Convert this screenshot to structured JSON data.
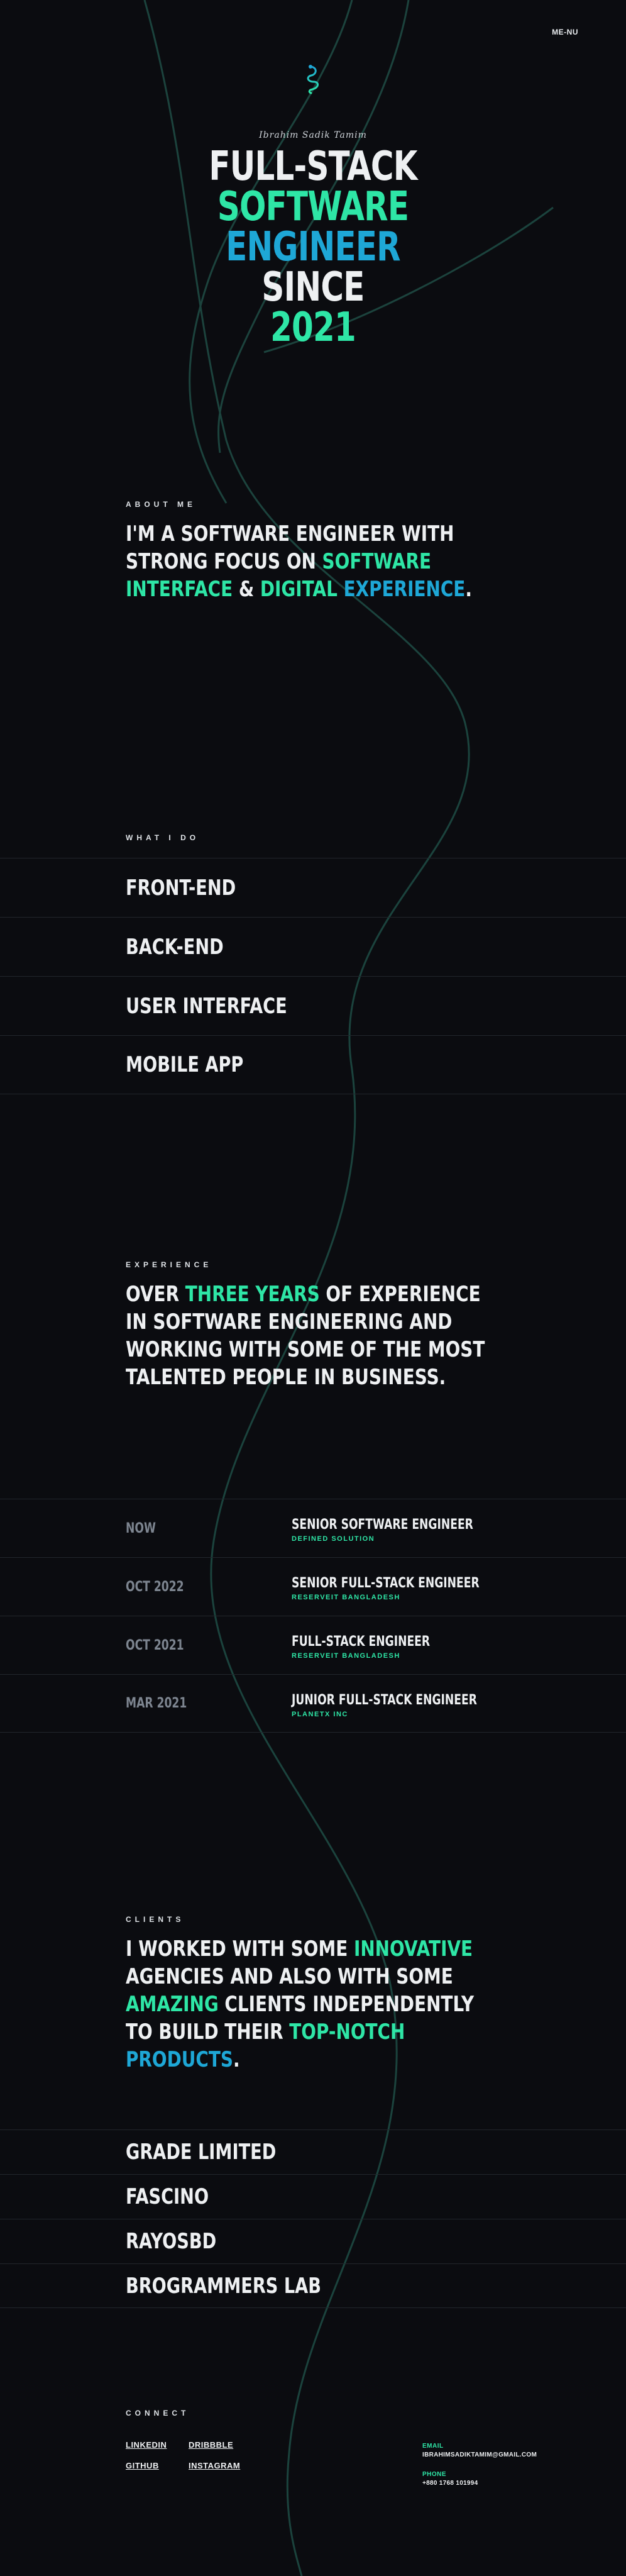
{
  "nav": {
    "menu_label": "ME-NU"
  },
  "hero": {
    "logo_icon": "serpent-logo-icon",
    "signature": "Ibrahim Sadik Tamim",
    "lines": [
      "FULL-STACK",
      "SOFTWARE",
      "ENGINEER",
      "SINCE",
      "2021"
    ]
  },
  "about": {
    "label": "ABOUT ME",
    "text_before": "I'M A SOFTWARE ENGINEER WITH STRONG FOCUS ON ",
    "highlight1": "SOFTWARE INTERFACE",
    "middle": " & ",
    "highlight2": "DIGITAL EXPERIENCE",
    "end": "."
  },
  "what_i_do": {
    "label": "WHAT I DO",
    "items": [
      "FRONT-END",
      "BACK-END",
      "USER INTERFACE",
      "MOBILE APP"
    ]
  },
  "experience": {
    "label": "EXPERIENCE",
    "text_before": "OVER ",
    "highlight": "THREE YEARS",
    "text_after": " OF EXPERIENCE IN SOFTWARE ENGINEERING AND WORKING WITH SOME OF THE MOST TALENTED PEOPLE IN BUSINESS.",
    "timeline": [
      {
        "date": "NOW",
        "role": "SENIOR SOFTWARE ENGINEER",
        "company": "DEFINED SOLUTION"
      },
      {
        "date": "OCT 2022",
        "role": "SENIOR FULL-STACK ENGINEER",
        "company": "RESERVEIT BANGLADESH"
      },
      {
        "date": "OCT 2021",
        "role": "FULL-STACK ENGINEER",
        "company": "RESERVEIT BANGLADESH"
      },
      {
        "date": "MAR 2021",
        "role": "JUNIOR FULL-STACK ENGINEER",
        "company": "PLANETX INC"
      }
    ]
  },
  "clients": {
    "label": "CLIENTS",
    "t1": "I WORKED WITH SOME ",
    "h1": "INNOVATIVE",
    "t2": " AGENCIES AND ALSO WITH SOME ",
    "h2": "AMAZING",
    "t3": " CLIENTS INDEPENDENTLY TO BUILD THEIR ",
    "h3": "TOP-NOTCH PRODUCTS",
    "t4": ".",
    "list": [
      "GRADE LIMITED",
      "FASCINO",
      "RAYOSBD",
      "BROGRAMMERS LAB"
    ]
  },
  "connect": {
    "label": "CONNECT",
    "links": [
      "LINKEDIN",
      "DRIBBBLE",
      "GITHUB",
      "INSTAGRAM"
    ],
    "email_label": "EMAIL",
    "email": "IBRAHIMSADIKTAMIM@GMAIL.COM",
    "phone_label": "PHONE",
    "phone": "+880 1768 101994"
  },
  "colors": {
    "background": "#0b0c10",
    "green": "#2ee6a6",
    "blue": "#1ea7d6",
    "line": "#1f4d45"
  }
}
